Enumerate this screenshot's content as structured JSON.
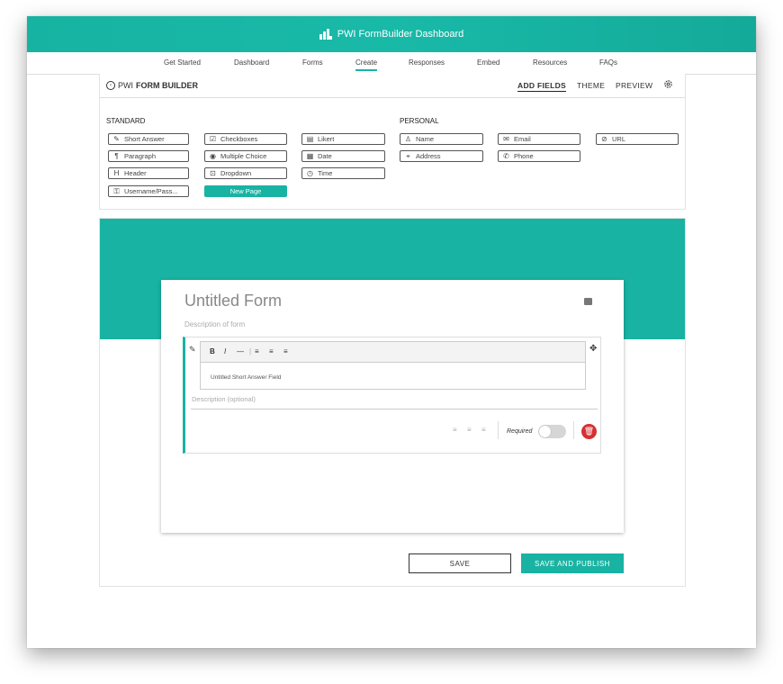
{
  "app": {
    "title": "PWI FormBuilder Dashboard",
    "accent": "#19b3a3"
  },
  "nav": {
    "items": [
      "Get Started",
      "Dashboard",
      "Forms",
      "Create",
      "Responses",
      "Embed",
      "Resources",
      "FAQs"
    ],
    "active": "Create"
  },
  "builder": {
    "brand_prefix": "PWI",
    "brand_main": "FORM BUILDER",
    "tabs": [
      "ADD FIELDS",
      "THEME",
      "PREVIEW"
    ],
    "active_tab": "ADD FIELDS",
    "standard_label": "STANDARD",
    "personal_label": "PERSONAL",
    "standard_fields": [
      {
        "label": "Short Answer",
        "icon": "pencil-icon"
      },
      {
        "label": "Paragraph",
        "icon": "paragraph-icon"
      },
      {
        "label": "Header",
        "icon": "header-icon"
      },
      {
        "label": "Username/Pass...",
        "icon": "key-icon"
      },
      {
        "label": "Checkboxes",
        "icon": "checkbox-icon"
      },
      {
        "label": "Multiple Choice",
        "icon": "radio-icon"
      },
      {
        "label": "Dropdown",
        "icon": "dropdown-icon"
      },
      {
        "label": "New Page",
        "icon": ""
      },
      {
        "label": "Likert",
        "icon": "likert-icon"
      },
      {
        "label": "Date",
        "icon": "calendar-icon"
      },
      {
        "label": "Time",
        "icon": "clock-icon"
      }
    ],
    "personal_fields": [
      {
        "label": "Name",
        "icon": "person-icon"
      },
      {
        "label": "Address",
        "icon": "location-icon"
      },
      {
        "label": "Email",
        "icon": "mail-icon"
      },
      {
        "label": "Phone",
        "icon": "phone-icon"
      },
      {
        "label": "URL",
        "icon": "link-icon"
      }
    ]
  },
  "form": {
    "title": "Untitled Form",
    "description_placeholder": "Description of form",
    "field": {
      "text": "Untitled Short Answer Field",
      "description_placeholder": "Description (optional)",
      "required_label": "Required",
      "required": false,
      "toolbar": [
        "B",
        "I",
        "—",
        "≡",
        "≡",
        "≡"
      ]
    }
  },
  "actions": {
    "save": "SAVE",
    "publish": "SAVE AND PUBLISH"
  }
}
